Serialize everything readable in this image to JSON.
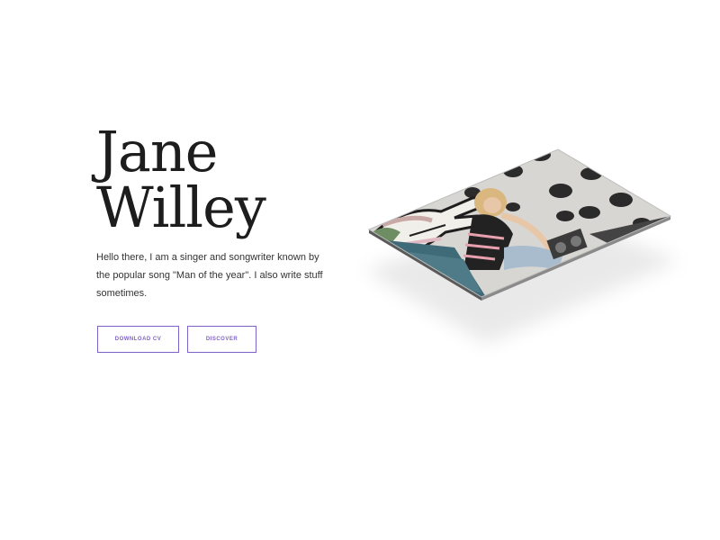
{
  "hero": {
    "first_name": "Jane",
    "last_name": "Willey",
    "bio": "Hello there, I am a singer and songwriter known by the popular song \"Man of the year\". I also write stuff sometimes."
  },
  "buttons": {
    "download_cv": "DOWNLOAD CV",
    "discover": "DISCOVER"
  },
  "colors": {
    "accent": "#7e62c7",
    "heading": "#1d1d1d",
    "shadow": "#eeeeee"
  }
}
